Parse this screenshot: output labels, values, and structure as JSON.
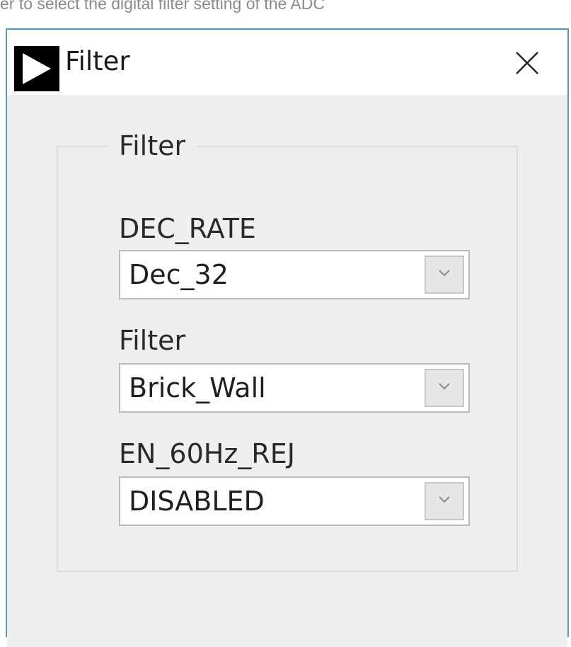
{
  "page_caption": "er to select the digital filter setting of the ADC",
  "window": {
    "title": "Filter",
    "app_icon": "play-triangle-icon",
    "close_icon": "close-x-icon",
    "border_color": "#5a96c4"
  },
  "group": {
    "label": "Filter"
  },
  "fields": [
    {
      "label": "DEC_RATE",
      "selected_value": "Dec_32",
      "dropdown_icon": "chevron-down-icon"
    },
    {
      "label": "Filter",
      "selected_value": "Brick_Wall",
      "dropdown_icon": "chevron-down-icon"
    },
    {
      "label": "EN_60Hz_REJ",
      "selected_value": "DISABLED",
      "dropdown_icon": "chevron-down-icon"
    }
  ]
}
